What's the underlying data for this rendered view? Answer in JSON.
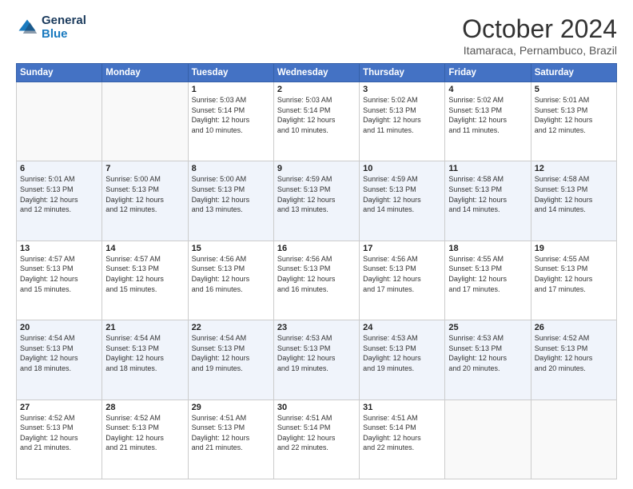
{
  "header": {
    "logo_line1": "General",
    "logo_line2": "Blue",
    "title": "October 2024",
    "subtitle": "Itamaraca, Pernambuco, Brazil"
  },
  "columns": [
    "Sunday",
    "Monday",
    "Tuesday",
    "Wednesday",
    "Thursday",
    "Friday",
    "Saturday"
  ],
  "weeks": [
    [
      {
        "day": "",
        "info": ""
      },
      {
        "day": "",
        "info": ""
      },
      {
        "day": "1",
        "info": "Sunrise: 5:03 AM\nSunset: 5:14 PM\nDaylight: 12 hours\nand 10 minutes."
      },
      {
        "day": "2",
        "info": "Sunrise: 5:03 AM\nSunset: 5:14 PM\nDaylight: 12 hours\nand 10 minutes."
      },
      {
        "day": "3",
        "info": "Sunrise: 5:02 AM\nSunset: 5:13 PM\nDaylight: 12 hours\nand 11 minutes."
      },
      {
        "day": "4",
        "info": "Sunrise: 5:02 AM\nSunset: 5:13 PM\nDaylight: 12 hours\nand 11 minutes."
      },
      {
        "day": "5",
        "info": "Sunrise: 5:01 AM\nSunset: 5:13 PM\nDaylight: 12 hours\nand 12 minutes."
      }
    ],
    [
      {
        "day": "6",
        "info": "Sunrise: 5:01 AM\nSunset: 5:13 PM\nDaylight: 12 hours\nand 12 minutes."
      },
      {
        "day": "7",
        "info": "Sunrise: 5:00 AM\nSunset: 5:13 PM\nDaylight: 12 hours\nand 12 minutes."
      },
      {
        "day": "8",
        "info": "Sunrise: 5:00 AM\nSunset: 5:13 PM\nDaylight: 12 hours\nand 13 minutes."
      },
      {
        "day": "9",
        "info": "Sunrise: 4:59 AM\nSunset: 5:13 PM\nDaylight: 12 hours\nand 13 minutes."
      },
      {
        "day": "10",
        "info": "Sunrise: 4:59 AM\nSunset: 5:13 PM\nDaylight: 12 hours\nand 14 minutes."
      },
      {
        "day": "11",
        "info": "Sunrise: 4:58 AM\nSunset: 5:13 PM\nDaylight: 12 hours\nand 14 minutes."
      },
      {
        "day": "12",
        "info": "Sunrise: 4:58 AM\nSunset: 5:13 PM\nDaylight: 12 hours\nand 14 minutes."
      }
    ],
    [
      {
        "day": "13",
        "info": "Sunrise: 4:57 AM\nSunset: 5:13 PM\nDaylight: 12 hours\nand 15 minutes."
      },
      {
        "day": "14",
        "info": "Sunrise: 4:57 AM\nSunset: 5:13 PM\nDaylight: 12 hours\nand 15 minutes."
      },
      {
        "day": "15",
        "info": "Sunrise: 4:56 AM\nSunset: 5:13 PM\nDaylight: 12 hours\nand 16 minutes."
      },
      {
        "day": "16",
        "info": "Sunrise: 4:56 AM\nSunset: 5:13 PM\nDaylight: 12 hours\nand 16 minutes."
      },
      {
        "day": "17",
        "info": "Sunrise: 4:56 AM\nSunset: 5:13 PM\nDaylight: 12 hours\nand 17 minutes."
      },
      {
        "day": "18",
        "info": "Sunrise: 4:55 AM\nSunset: 5:13 PM\nDaylight: 12 hours\nand 17 minutes."
      },
      {
        "day": "19",
        "info": "Sunrise: 4:55 AM\nSunset: 5:13 PM\nDaylight: 12 hours\nand 17 minutes."
      }
    ],
    [
      {
        "day": "20",
        "info": "Sunrise: 4:54 AM\nSunset: 5:13 PM\nDaylight: 12 hours\nand 18 minutes."
      },
      {
        "day": "21",
        "info": "Sunrise: 4:54 AM\nSunset: 5:13 PM\nDaylight: 12 hours\nand 18 minutes."
      },
      {
        "day": "22",
        "info": "Sunrise: 4:54 AM\nSunset: 5:13 PM\nDaylight: 12 hours\nand 19 minutes."
      },
      {
        "day": "23",
        "info": "Sunrise: 4:53 AM\nSunset: 5:13 PM\nDaylight: 12 hours\nand 19 minutes."
      },
      {
        "day": "24",
        "info": "Sunrise: 4:53 AM\nSunset: 5:13 PM\nDaylight: 12 hours\nand 19 minutes."
      },
      {
        "day": "25",
        "info": "Sunrise: 4:53 AM\nSunset: 5:13 PM\nDaylight: 12 hours\nand 20 minutes."
      },
      {
        "day": "26",
        "info": "Sunrise: 4:52 AM\nSunset: 5:13 PM\nDaylight: 12 hours\nand 20 minutes."
      }
    ],
    [
      {
        "day": "27",
        "info": "Sunrise: 4:52 AM\nSunset: 5:13 PM\nDaylight: 12 hours\nand 21 minutes."
      },
      {
        "day": "28",
        "info": "Sunrise: 4:52 AM\nSunset: 5:13 PM\nDaylight: 12 hours\nand 21 minutes."
      },
      {
        "day": "29",
        "info": "Sunrise: 4:51 AM\nSunset: 5:13 PM\nDaylight: 12 hours\nand 21 minutes."
      },
      {
        "day": "30",
        "info": "Sunrise: 4:51 AM\nSunset: 5:14 PM\nDaylight: 12 hours\nand 22 minutes."
      },
      {
        "day": "31",
        "info": "Sunrise: 4:51 AM\nSunset: 5:14 PM\nDaylight: 12 hours\nand 22 minutes."
      },
      {
        "day": "",
        "info": ""
      },
      {
        "day": "",
        "info": ""
      }
    ]
  ]
}
